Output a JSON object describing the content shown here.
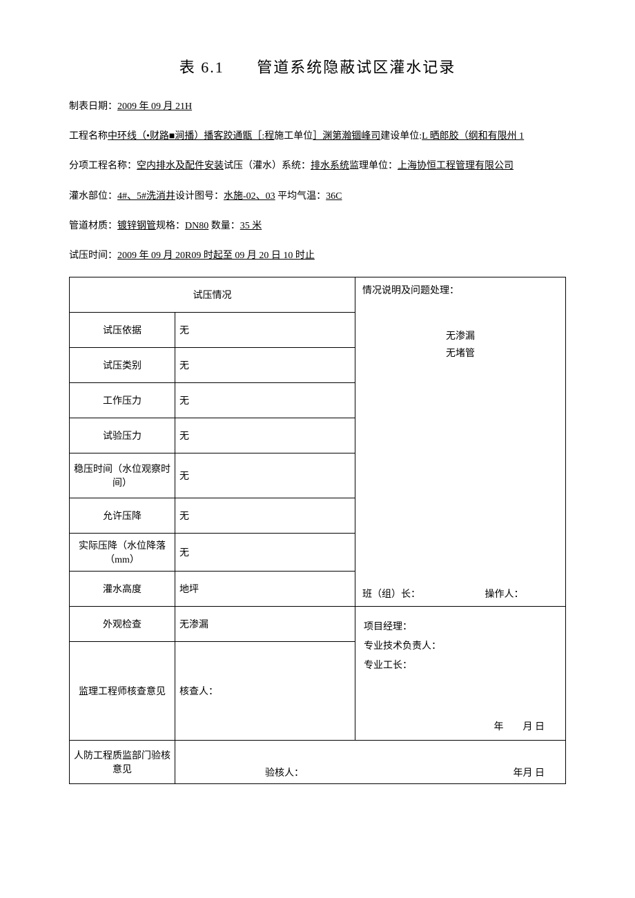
{
  "title_num": "表 6.1",
  "title_text": "管道系统隐蔽试区灌水记录",
  "date_label": "制表日期：",
  "date_value": "2009 年 09 月 21H",
  "line1": {
    "l1": "工程名称",
    "v1": "中环线（•财路■涧播）播客跤通甑［:程",
    "l2": "施工单位",
    "v2": "］渊第瀚锢峰司",
    "l3": "建设单位:",
    "v3": "L 晒郎胶（纲和有限州 1"
  },
  "line2": {
    "l1": "分项工程名称：",
    "v1": "空内排水及配件安装",
    "l2": "试压（灌水）系统：",
    "v2": "排水系统",
    "l3": "监理单位：",
    "v3": "上海协恒工程管理有限公司"
  },
  "line3": {
    "l1": "灌水部位：",
    "v1": "4#、5#洗消井",
    "l2": "设计图号：",
    "v2": "水施-02、03",
    "l3": " 平均气温：",
    "v3": "36C"
  },
  "line4": {
    "l1": "管道材质：",
    "v1": "镀锌钢管",
    "l2": "规格：",
    "v2": "DN80",
    "l3": " 数量：",
    "v3": "35 米"
  },
  "line5": {
    "l1": "试压时间：",
    "v1": "2009 年 09 月 20R09 时起至 09 月 20 日 10 时止"
  },
  "table": {
    "header": "试压情况",
    "situation_label": "情况说明及问题处理：",
    "situation_text1": "无渗漏",
    "situation_text2": "无堵管",
    "team_leader": "班（组）长：",
    "operator": "操作人：",
    "rows": [
      {
        "label": "试压依据",
        "value": "无"
      },
      {
        "label": "试压类别",
        "value": "无"
      },
      {
        "label": "工作压力",
        "value": "无"
      },
      {
        "label": "试验压力",
        "value": "无"
      },
      {
        "label": "稳压时间（水位观察时间）",
        "value": "无"
      },
      {
        "label": "允许压降",
        "value": "无"
      },
      {
        "label": "实际压降（水位降落（mm）",
        "value": "无"
      },
      {
        "label": "灌水高度",
        "value": "地坪"
      },
      {
        "label": "外观检查",
        "value": "无渗漏"
      }
    ],
    "supervisor_label": "监理工程师核查意见",
    "checker": "核查人：",
    "pm": "项目经理：",
    "tech": "专业技术负责人：",
    "foreman": "专业工长：",
    "date_ymd": "年　　月 日",
    "defense_label": "人防工程质监部门验核意见",
    "verifier": "验核人：",
    "verify_date": "年月 日"
  }
}
